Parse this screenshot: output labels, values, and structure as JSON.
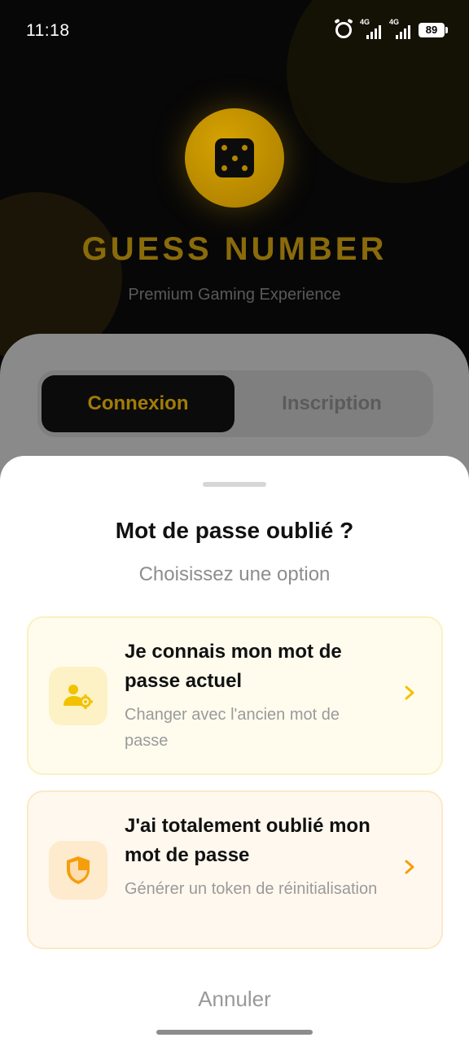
{
  "status_bar": {
    "time": "11:18",
    "network_1": "4G",
    "network_2": "4G",
    "battery": "89"
  },
  "brand": {
    "icon": "dice-icon",
    "title": "GUESS NUMBER",
    "subtitle": "Premium Gaming Experience",
    "accent_color": "#D6A300"
  },
  "auth_tabs": {
    "login": "Connexion",
    "register": "Inscription",
    "selected": "Connexion"
  },
  "sheet": {
    "title": "Mot de passe oublié ?",
    "subtitle": "Choisissez une option",
    "options": [
      {
        "title": "Je connais mon mot de passe actuel",
        "description": "Changer avec l'ancien mot de passe",
        "icon": "user-gear-icon",
        "color": "#F2C200"
      },
      {
        "title": "J'ai totalement oublié mon mot de passe",
        "description": "Générer un token de réinitialisation",
        "icon": "shield-icon",
        "color": "#F59E0B"
      }
    ],
    "cancel_label": "Annuler"
  }
}
